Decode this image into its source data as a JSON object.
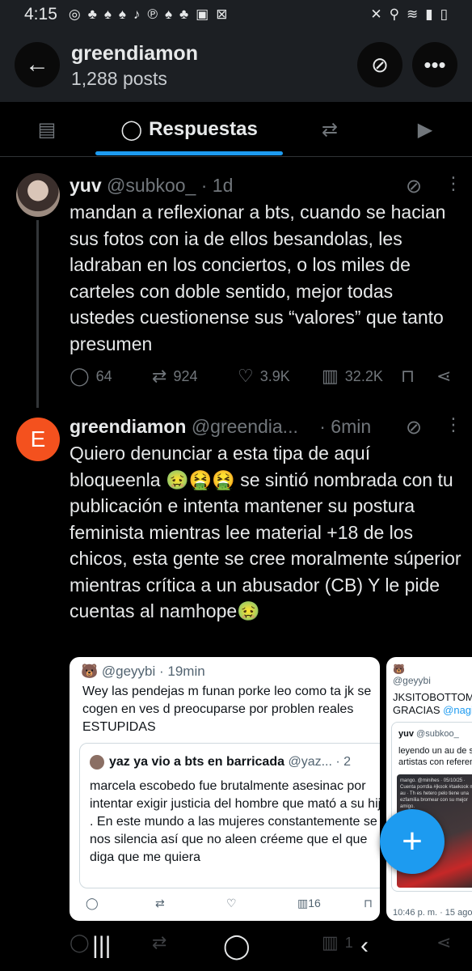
{
  "status_bar": {
    "time": "4:15",
    "left_icons": [
      "instagram-icon",
      "snapchat-icon",
      "snapchat-icon",
      "snapchat-icon",
      "tiktok-icon",
      "pinterest-icon",
      "snapchat-icon",
      "snapchat-icon",
      "gallery-icon",
      "close-box-icon"
    ],
    "right_icons": [
      "mute-icon",
      "location-icon",
      "wifi-icon",
      "signal-icon",
      "battery-icon"
    ]
  },
  "header": {
    "title": "greendiamon",
    "subtitle": "1,288 posts"
  },
  "tabs": [
    {
      "label": "",
      "icon": "news-icon"
    },
    {
      "label": "Respuestas",
      "icon": "reply-bubble-icon",
      "active": true
    },
    {
      "label": "",
      "icon": "repost-icon"
    },
    {
      "label": "",
      "icon": "media-play-icon"
    }
  ],
  "posts": [
    {
      "name": "yuv",
      "handle": "@subkoo_",
      "time": "· 1d",
      "text": "mandan a reflexionar a bts, cuando se hacian sus fotos con ia de ellos besandolas, les ladraban en los conciertos, o los miles de carteles con doble sentido, mejor todas ustedes cuestionense sus “valores” que tanto presumen",
      "replies": "64",
      "reposts": "924",
      "likes": "3.9K",
      "views": "32.2K"
    },
    {
      "avatar_letter": "E",
      "avatar_color": "#f4511e",
      "name": "greendiamon",
      "handle": "@greendia...",
      "time": "· 6min",
      "text": "Quiero denunciar a esta tipa de aquí bloqueenla 🤢🤮🤮 se sintió nombrada con tu publicación e intenta mantener su postura feminista mientras lee material +18 de los chicos, esta gente se cree moralmente súperior mientras crítica a un abusador (CB) Y le pide cuentas al namhope🤢"
    }
  ],
  "media_cards": [
    {
      "header": "🐻 @geyybi · 19min",
      "text": "Wey las pendejas m funan porke leo como ta jk se cogen en ves d preocuparse por problen reales ESTUPIDAS",
      "quote_name": "yaz ya vio a bts en barricada",
      "quote_handle": "@yaz... · 2",
      "quote_text": "marcela escobedo fue brutalmente asesinac por intentar exigir justicia del hombre que mató a su hija . En este mundo a las mujeres constantemente se nos silencia así que no aleen créeme que el que diga que me quiera",
      "views": "16"
    },
    {
      "header_emoji": "🐻",
      "header_handle": "@geyybi",
      "text_line1": "JKSITOBOTTOM l",
      "text_line2": "GRACIAS",
      "mention": "@nagiza",
      "quote_name": "yuv",
      "quote_handle": "@subkoo_",
      "quote_line1": "leyendo un au de s",
      "quote_line2": "artistas con referen",
      "image_text": "mango. @minihes · 05/10/25 · Cuenta porrdia #jkook #taekook mini au · Th es hetero pelo tiene una ezfamilia bromear con su mejor amigo.",
      "time": "10:46 p. m. · 15 ago"
    }
  ],
  "fab_label": "+",
  "nav": {
    "recent_icon": "|||",
    "home_icon": "◯",
    "back_icon": "‹"
  },
  "bottom_partial": {
    "views": "1"
  }
}
